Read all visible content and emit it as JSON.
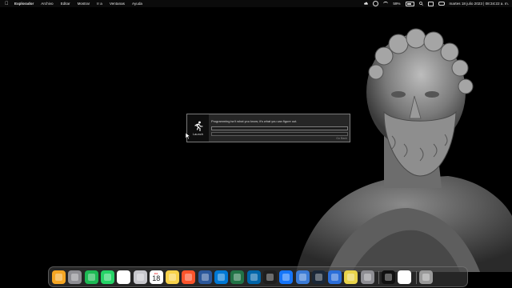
{
  "menubar": {
    "app_name": "Explorador",
    "items": [
      "Archivo",
      "Editar",
      "Mostrar",
      "Ir a",
      "Ventanas",
      "Ayuda"
    ],
    "battery": "59%",
    "clock": "martes 18 julio 2023 | 08:34:22 a. m."
  },
  "dialog": {
    "app_label": "Launch",
    "message": "Programming isn't what you know; it's what you can figure out.",
    "button": "Go Back",
    "progress": 0.0
  },
  "dock": {
    "calendar": {
      "month": "JUL",
      "day": "18"
    },
    "icons": [
      {
        "name": "home-app-icon",
        "color": "#f5a623"
      },
      {
        "name": "launchpad-icon",
        "color": "#8e8e93"
      },
      {
        "name": "spotify-icon",
        "color": "#1db954"
      },
      {
        "name": "whatsapp-icon",
        "color": "#25d366"
      },
      {
        "name": "notion-icon",
        "color": "#ffffff"
      },
      {
        "name": "settings-icon",
        "color": "#c7c7cc"
      },
      {
        "name": "calendar-icon",
        "color": "#ffffff"
      },
      {
        "name": "notes-icon",
        "color": "#f7d14a"
      },
      {
        "name": "brave-icon",
        "color": "#fb542b"
      },
      {
        "name": "word-icon",
        "color": "#2b579a"
      },
      {
        "name": "outlook-icon",
        "color": "#0078d4"
      },
      {
        "name": "excel-icon",
        "color": "#217346"
      },
      {
        "name": "vscode-icon",
        "color": "#0065a9"
      },
      {
        "name": "intellij-icon",
        "color": "#1e1e1e"
      },
      {
        "name": "xcode-icon",
        "color": "#1575f9"
      },
      {
        "name": "word2-icon",
        "color": "#3b7bd6"
      },
      {
        "name": "steam-icon",
        "color": "#1b2838"
      },
      {
        "name": "downloader-icon",
        "color": "#2b6ed9"
      },
      {
        "name": "jvisualvm-icon",
        "color": "#e8d34a"
      },
      {
        "name": "disk-utility-icon",
        "color": "#8e8e93"
      },
      {
        "name": "launch-app-icon",
        "color": "#111111"
      },
      {
        "name": "java-icon",
        "color": "#ffffff"
      },
      {
        "name": "trash-icon",
        "color": "#9a9a9a"
      }
    ]
  }
}
